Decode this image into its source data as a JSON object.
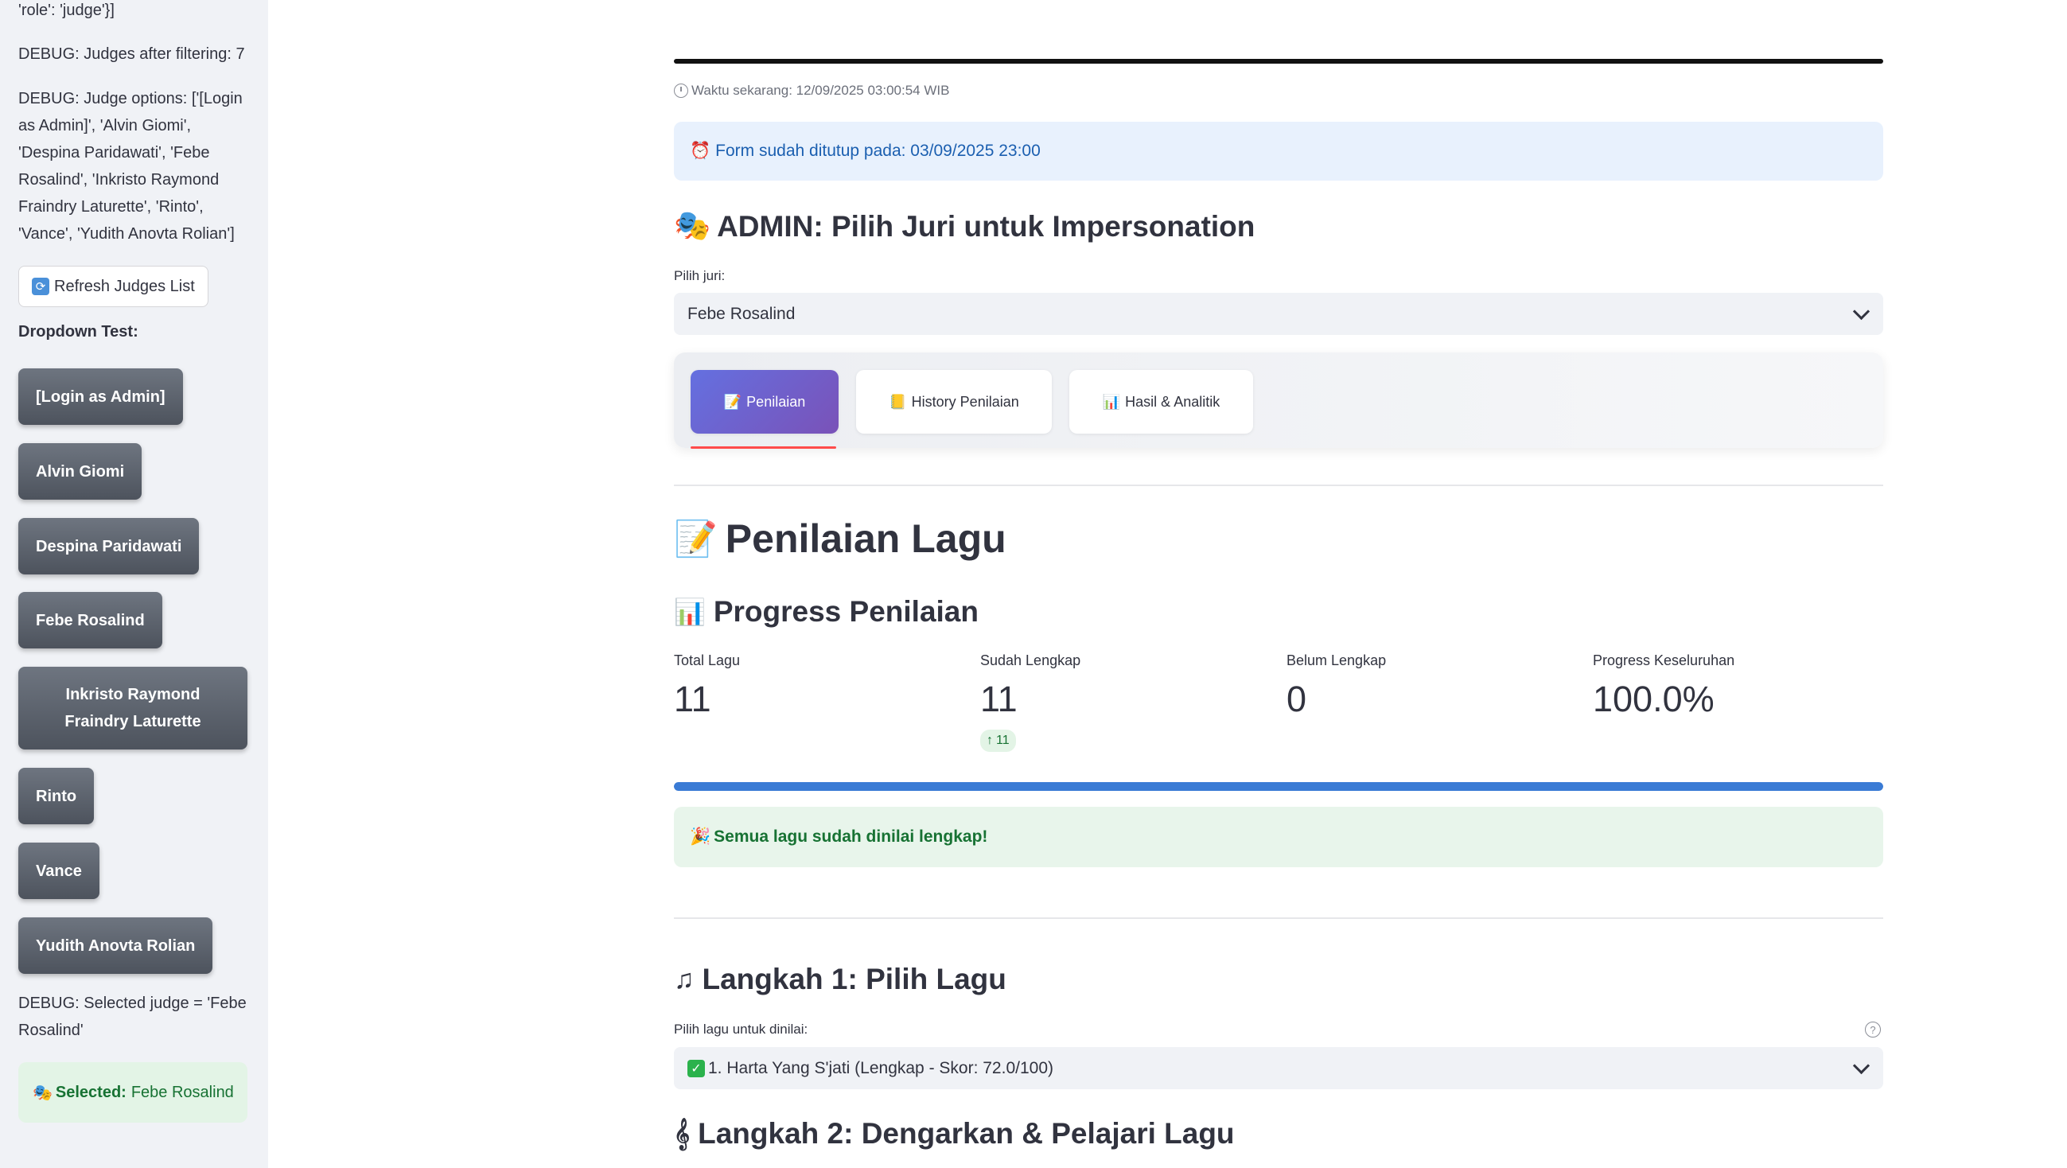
{
  "sidebar": {
    "debug_role_tail": "'role': 'judge'}]",
    "debug_judges_after_filtering": "DEBUG: Judges after filtering: 7",
    "debug_judge_options": "DEBUG: Judge options: ['[Login as Admin]', 'Alvin Giomi', 'Despina Paridawati', 'Febe Rosalind', 'Inkristo Raymond Fraindry Laturette', 'Rinto', 'Vance', 'Yudith Anovta Rolian']",
    "refresh_button": "Refresh Judges List",
    "dropdown_test_label": "Dropdown Test:",
    "judges": [
      "[Login as Admin]",
      "Alvin Giomi",
      "Despina Paridawati",
      "Febe Rosalind",
      "Inkristo Raymond Fraindry Laturette",
      "Rinto",
      "Vance",
      "Yudith Anovta Rolian"
    ],
    "debug_selected_judge": "DEBUG: Selected judge = 'Febe Rosalind'",
    "selected_label": "Selected:",
    "selected_value": "Febe Rosalind"
  },
  "main": {
    "current_time": "Waktu sekarang: 12/09/2025 03:00:54 WIB",
    "form_closed": "Form sudah ditutup pada: 03/09/2025 23:00",
    "admin_heading": "ADMIN: Pilih Juri untuk Impersonation",
    "judge_select_label": "Pilih juri:",
    "judge_select_value": "Febe Rosalind",
    "tabs": [
      {
        "label": "Penilaian",
        "icon": "memo-icon"
      },
      {
        "label": "History Penilaian",
        "icon": "ledger-icon"
      },
      {
        "label": "Hasil & Analitik",
        "icon": "bar-chart-icon"
      }
    ],
    "page_title": "Penilaian Lagu",
    "progress_heading": "Progress Penilaian",
    "metrics": [
      {
        "label": "Total Lagu",
        "value": "11"
      },
      {
        "label": "Sudah Lengkap",
        "value": "11",
        "delta": "11"
      },
      {
        "label": "Belum Lengkap",
        "value": "0"
      },
      {
        "label": "Progress Keseluruhan",
        "value": "100.0%"
      }
    ],
    "progress_fraction": 1.0,
    "success_message": "Semua lagu sudah dinilai lengkap!",
    "step1_heading": "Langkah 1: Pilih Lagu",
    "song_select_label": "Pilih lagu untuk dinilai:",
    "song_select_value": "1. Harta Yang S'jati (Lengkap - Skor: 72.0/100)",
    "step2_heading": "Langkah 2: Dengarkan & Pelajari Lagu"
  },
  "colors": {
    "accent_blue": "#3a7bd5",
    "tab_active_gradient_start": "#6470e0",
    "tab_active_gradient_end": "#7a52b8",
    "success_green": "#177233",
    "info_blue": "#1b5fb0",
    "tab_underline": "#ff4b4b"
  }
}
